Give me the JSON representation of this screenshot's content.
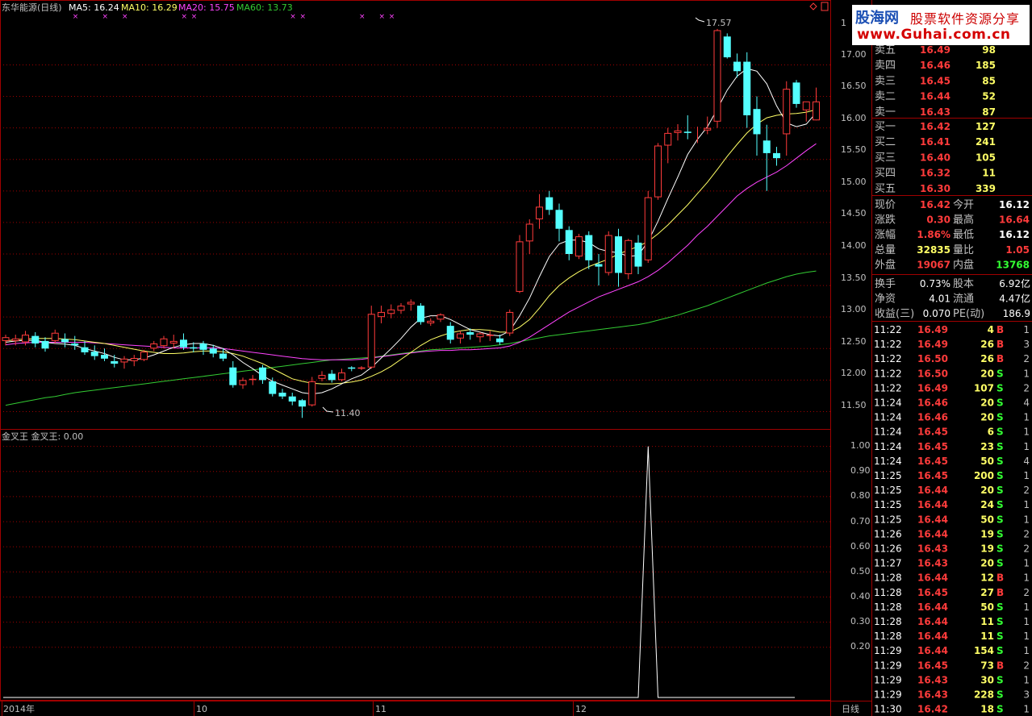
{
  "header": {
    "stock_title": "东华能源(日线)",
    "ma5": "MA5: 16.24",
    "ma10": "MA10: 16.29",
    "ma20": "MA20: 15.75",
    "ma60": "MA60: 13.73"
  },
  "colors": {
    "up": "#ff3b3b",
    "down": "#54ffff",
    "ma5": "#ffffff",
    "ma10": "#ffff66",
    "ma20": "#ff44ff",
    "ma60": "#33cc33",
    "grid": "#a00000"
  },
  "price_axis": {
    "ticks": [
      "17.00",
      "16.50",
      "16.00",
      "15.50",
      "15.00",
      "14.50",
      "14.00",
      "13.50",
      "13.00",
      "12.50",
      "12.00",
      "11.50"
    ],
    "top_partial": "1"
  },
  "annotations": {
    "high": "17.57",
    "low": "11.40"
  },
  "indicator": {
    "title": "金叉王 金叉王: 0.00",
    "ticks": [
      "1.00",
      "0.90",
      "0.80",
      "0.70",
      "0.60",
      "0.50",
      "0.40",
      "0.30",
      "0.20"
    ]
  },
  "date_axis": {
    "labels": [
      "2014年",
      "10",
      "11",
      "12"
    ],
    "period": "日线"
  },
  "logo": {
    "site": "股海网",
    "slogan": "股票软件资源分享",
    "url": "www.Guhai.com.cn"
  },
  "order_book": {
    "asks": [
      {
        "label": "卖五",
        "price": "16.49",
        "vol": "98"
      },
      {
        "label": "卖四",
        "price": "16.46",
        "vol": "185"
      },
      {
        "label": "卖三",
        "price": "16.45",
        "vol": "85"
      },
      {
        "label": "卖二",
        "price": "16.44",
        "vol": "52"
      },
      {
        "label": "卖一",
        "price": "16.43",
        "vol": "87"
      }
    ],
    "bids": [
      {
        "label": "买一",
        "price": "16.42",
        "vol": "127"
      },
      {
        "label": "买二",
        "price": "16.41",
        "vol": "241"
      },
      {
        "label": "买三",
        "price": "16.40",
        "vol": "105"
      },
      {
        "label": "买四",
        "price": "16.32",
        "vol": "11"
      },
      {
        "label": "买五",
        "price": "16.30",
        "vol": "339"
      }
    ]
  },
  "quote": [
    {
      "l1": "现价",
      "v1": "16.42",
      "l2": "今开",
      "v2": "16.12",
      "c1": "#ff3b3b",
      "c2": "#ffffff"
    },
    {
      "l1": "涨跌",
      "v1": "0.30",
      "l2": "最高",
      "v2": "16.64",
      "c1": "#ff3b3b",
      "c2": "#ff3b3b"
    },
    {
      "l1": "涨幅",
      "v1": "1.86%",
      "l2": "最低",
      "v2": "16.12",
      "c1": "#ff3b3b",
      "c2": "#ffffff"
    },
    {
      "l1": "总量",
      "v1": "32835",
      "l2": "量比",
      "v2": "1.05",
      "c1": "#ffff66",
      "c2": "#ff3b3b"
    },
    {
      "l1": "外盘",
      "v1": "19067",
      "l2": "内盘",
      "v2": "13768",
      "c1": "#ff3b3b",
      "c2": "#33ff33"
    }
  ],
  "fundamentals": [
    {
      "l1": "换手",
      "v1": "0.73%",
      "l2": "股本",
      "v2": "6.92亿"
    },
    {
      "l1": "净资",
      "v1": "4.01",
      "l2": "流通",
      "v2": "4.47亿"
    },
    {
      "l1": "收益(三)",
      "v1": "0.070",
      "l2": "PE(动)",
      "v2": "186.9"
    }
  ],
  "ticks": [
    {
      "time": "11:22",
      "price": "16.49",
      "vol": "4",
      "side": "B",
      "n": "1"
    },
    {
      "time": "11:22",
      "price": "16.49",
      "vol": "26",
      "side": "B",
      "n": "3"
    },
    {
      "time": "11:22",
      "price": "16.50",
      "vol": "26",
      "side": "B",
      "n": "2"
    },
    {
      "time": "11:22",
      "price": "16.50",
      "vol": "20",
      "side": "S",
      "n": "1"
    },
    {
      "time": "11:22",
      "price": "16.49",
      "vol": "107",
      "side": "S",
      "n": "2"
    },
    {
      "time": "11:24",
      "price": "16.46",
      "vol": "20",
      "side": "S",
      "n": "4"
    },
    {
      "time": "11:24",
      "price": "16.46",
      "vol": "20",
      "side": "S",
      "n": "1"
    },
    {
      "time": "11:24",
      "price": "16.45",
      "vol": "6",
      "side": "S",
      "n": "1"
    },
    {
      "time": "11:24",
      "price": "16.45",
      "vol": "23",
      "side": "S",
      "n": "1"
    },
    {
      "time": "11:24",
      "price": "16.45",
      "vol": "50",
      "side": "S",
      "n": "4"
    },
    {
      "time": "11:25",
      "price": "16.45",
      "vol": "200",
      "side": "S",
      "n": "1"
    },
    {
      "time": "11:25",
      "price": "16.44",
      "vol": "20",
      "side": "S",
      "n": "2"
    },
    {
      "time": "11:25",
      "price": "16.44",
      "vol": "24",
      "side": "S",
      "n": "1"
    },
    {
      "time": "11:25",
      "price": "16.44",
      "vol": "50",
      "side": "S",
      "n": "1"
    },
    {
      "time": "11:26",
      "price": "16.44",
      "vol": "19",
      "side": "S",
      "n": "2"
    },
    {
      "time": "11:26",
      "price": "16.43",
      "vol": "19",
      "side": "S",
      "n": "2"
    },
    {
      "time": "11:27",
      "price": "16.43",
      "vol": "20",
      "side": "S",
      "n": "1"
    },
    {
      "time": "11:28",
      "price": "16.44",
      "vol": "12",
      "side": "B",
      "n": "1"
    },
    {
      "time": "11:28",
      "price": "16.45",
      "vol": "27",
      "side": "B",
      "n": "2"
    },
    {
      "time": "11:28",
      "price": "16.44",
      "vol": "50",
      "side": "S",
      "n": "1"
    },
    {
      "time": "11:28",
      "price": "16.44",
      "vol": "11",
      "side": "S",
      "n": "1"
    },
    {
      "time": "11:28",
      "price": "16.44",
      "vol": "11",
      "side": "S",
      "n": "1"
    },
    {
      "time": "11:29",
      "price": "16.44",
      "vol": "154",
      "side": "S",
      "n": "1"
    },
    {
      "time": "11:29",
      "price": "16.45",
      "vol": "73",
      "side": "B",
      "n": "2"
    },
    {
      "time": "11:29",
      "price": "16.43",
      "vol": "30",
      "side": "S",
      "n": "1"
    },
    {
      "time": "11:29",
      "price": "16.43",
      "vol": "228",
      "side": "S",
      "n": "3"
    },
    {
      "time": "11:30",
      "price": "16.42",
      "vol": "18",
      "side": "S",
      "n": "1"
    }
  ],
  "chart_data": {
    "type": "candlestick",
    "candles": [
      [
        12.62,
        12.72,
        12.55,
        12.68
      ],
      [
        12.62,
        12.72,
        12.55,
        12.66
      ],
      [
        12.6,
        12.78,
        12.55,
        12.72
      ],
      [
        12.7,
        12.76,
        12.52,
        12.58
      ],
      [
        12.62,
        12.68,
        12.45,
        12.5
      ],
      [
        12.62,
        12.8,
        12.58,
        12.75
      ],
      [
        12.65,
        12.74,
        12.52,
        12.6
      ],
      [
        12.58,
        12.7,
        12.48,
        12.55
      ],
      [
        12.52,
        12.62,
        12.4,
        12.44
      ],
      [
        12.45,
        12.55,
        12.32,
        12.38
      ],
      [
        12.4,
        12.5,
        12.3,
        12.34
      ],
      [
        12.3,
        12.4,
        12.2,
        12.26
      ],
      [
        12.28,
        12.38,
        12.18,
        12.34
      ],
      [
        12.3,
        12.4,
        12.22,
        12.35
      ],
      [
        12.32,
        12.48,
        12.3,
        12.45
      ],
      [
        12.5,
        12.62,
        12.46,
        12.58
      ],
      [
        12.54,
        12.7,
        12.5,
        12.66
      ],
      [
        12.58,
        12.72,
        12.5,
        12.62
      ],
      [
        12.64,
        12.74,
        12.48,
        12.52
      ],
      [
        12.52,
        12.6,
        12.44,
        12.5
      ],
      [
        12.58,
        12.62,
        12.4,
        12.48
      ],
      [
        12.5,
        12.56,
        12.36,
        12.42
      ],
      [
        12.42,
        12.5,
        12.3,
        12.34
      ],
      [
        12.2,
        12.3,
        11.88,
        11.92
      ],
      [
        11.92,
        12.04,
        11.86,
        12.0
      ],
      [
        12.0,
        12.08,
        11.92,
        12.02
      ],
      [
        12.2,
        12.24,
        11.94,
        12.0
      ],
      [
        11.98,
        12.04,
        11.74,
        11.78
      ],
      [
        11.8,
        11.86,
        11.7,
        11.74
      ],
      [
        11.74,
        11.8,
        11.6,
        11.66
      ],
      [
        11.68,
        11.7,
        11.4,
        11.58
      ],
      [
        11.6,
        12.05,
        11.58,
        11.98
      ],
      [
        12.02,
        12.14,
        11.98,
        12.08
      ],
      [
        12.1,
        12.16,
        11.96,
        12.0
      ],
      [
        12.0,
        12.18,
        11.98,
        12.12
      ],
      [
        12.2,
        12.22,
        12.14,
        12.18
      ],
      [
        12.18,
        12.22,
        12.16,
        12.2
      ],
      [
        12.2,
        13.18,
        12.18,
        13.05
      ],
      [
        13.0,
        13.18,
        12.9,
        13.08
      ],
      [
        13.05,
        13.2,
        12.98,
        13.12
      ],
      [
        13.1,
        13.22,
        13.05,
        13.18
      ],
      [
        13.2,
        13.28,
        13.1,
        13.24
      ],
      [
        13.18,
        13.22,
        12.88,
        12.92
      ],
      [
        12.9,
        12.98,
        12.86,
        12.94
      ],
      [
        12.96,
        13.06,
        12.92,
        13.04
      ],
      [
        12.86,
        12.92,
        12.58,
        12.64
      ],
      [
        12.66,
        12.78,
        12.58,
        12.74
      ],
      [
        12.76,
        12.82,
        12.64,
        12.72
      ],
      [
        12.68,
        12.76,
        12.6,
        12.74
      ],
      [
        12.7,
        12.78,
        12.62,
        12.72
      ],
      [
        12.66,
        12.72,
        12.56,
        12.6
      ],
      [
        12.74,
        13.12,
        12.7,
        13.08
      ],
      [
        13.4,
        14.3,
        13.38,
        14.2
      ],
      [
        14.2,
        14.55,
        14.0,
        14.48
      ],
      [
        14.55,
        14.95,
        14.4,
        14.75
      ],
      [
        14.9,
        15.0,
        14.62,
        14.7
      ],
      [
        14.7,
        14.8,
        14.2,
        14.4
      ],
      [
        14.38,
        14.44,
        13.9,
        14.0
      ],
      [
        13.96,
        14.32,
        13.92,
        14.28
      ],
      [
        14.3,
        14.36,
        13.76,
        13.9
      ],
      [
        13.84,
        14.0,
        13.5,
        13.8
      ],
      [
        13.7,
        14.36,
        13.66,
        14.3
      ],
      [
        14.28,
        14.4,
        13.48,
        13.7
      ],
      [
        13.68,
        14.24,
        13.6,
        14.22
      ],
      [
        14.18,
        14.3,
        13.68,
        13.8
      ],
      [
        13.9,
        15.0,
        13.86,
        14.9
      ],
      [
        14.9,
        15.76,
        14.86,
        15.72
      ],
      [
        15.72,
        16.0,
        15.44,
        15.92
      ],
      [
        15.92,
        16.06,
        15.8,
        15.96
      ],
      [
        15.94,
        16.2,
        15.82,
        15.92
      ],
      [
        15.9,
        16.02,
        15.76,
        15.9
      ],
      [
        15.96,
        16.18,
        15.9,
        16.0
      ],
      [
        16.1,
        17.57,
        16.0,
        17.55
      ],
      [
        17.45,
        17.5,
        17.1,
        17.12
      ],
      [
        17.05,
        17.18,
        16.8,
        16.9
      ],
      [
        17.05,
        17.2,
        16.0,
        16.2
      ],
      [
        16.3,
        16.5,
        15.56,
        15.9
      ],
      [
        15.8,
        16.05,
        15.0,
        15.6
      ],
      [
        15.6,
        15.7,
        15.4,
        15.52
      ],
      [
        15.9,
        16.74,
        15.56,
        16.62
      ],
      [
        16.72,
        16.76,
        16.32,
        16.38
      ],
      [
        16.28,
        16.4,
        16.1,
        16.42
      ],
      [
        16.12,
        16.64,
        16.12,
        16.42
      ]
    ],
    "ma5": [
      12.6,
      12.62,
      12.63,
      12.63,
      12.6,
      12.58,
      12.57,
      12.55,
      12.5,
      12.46,
      12.42,
      12.36,
      12.32,
      12.32,
      12.35,
      12.4,
      12.46,
      12.52,
      12.56,
      12.58,
      12.58,
      12.55,
      12.5,
      12.4,
      12.28,
      12.18,
      12.07,
      11.98,
      11.92,
      11.86,
      11.8,
      11.78,
      11.8,
      11.86,
      11.94,
      12.02,
      12.08,
      12.2,
      12.35,
      12.5,
      12.66,
      12.84,
      12.98,
      13.02,
      13.02,
      12.96,
      12.88,
      12.8,
      12.76,
      12.72,
      12.7,
      12.78,
      13.02,
      13.3,
      13.64,
      13.96,
      14.16,
      14.22,
      14.22,
      14.18,
      14.08,
      14.04,
      14.02,
      13.96,
      13.98,
      14.2,
      14.52,
      14.88,
      15.22,
      15.58,
      15.82,
      16.02,
      16.3,
      16.6,
      16.82,
      16.94,
      16.9,
      16.7,
      16.35,
      16.08,
      16.02,
      16.06,
      16.24
    ],
    "ma10": [
      12.62,
      12.64,
      12.65,
      12.66,
      12.66,
      12.66,
      12.65,
      12.64,
      12.62,
      12.6,
      12.58,
      12.55,
      12.52,
      12.49,
      12.46,
      12.44,
      12.42,
      12.42,
      12.43,
      12.45,
      12.46,
      12.46,
      12.45,
      12.42,
      12.38,
      12.32,
      12.26,
      12.18,
      12.1,
      12.02,
      11.98,
      11.95,
      11.94,
      11.94,
      11.95,
      11.97,
      12.0,
      12.06,
      12.13,
      12.22,
      12.33,
      12.44,
      12.55,
      12.64,
      12.7,
      12.75,
      12.78,
      12.8,
      12.8,
      12.79,
      12.76,
      12.76,
      12.84,
      12.96,
      13.14,
      13.34,
      13.5,
      13.62,
      13.72,
      13.8,
      13.86,
      13.92,
      14.0,
      14.06,
      14.12,
      14.2,
      14.32,
      14.46,
      14.62,
      14.78,
      14.96,
      15.14,
      15.34,
      15.55,
      15.74,
      15.92,
      16.06,
      16.16,
      16.2,
      16.22,
      16.23,
      16.25,
      16.29
    ],
    "ma20": [
      12.56,
      12.58,
      12.59,
      12.6,
      12.6,
      12.6,
      12.6,
      12.6,
      12.6,
      12.59,
      12.58,
      12.57,
      12.56,
      12.55,
      12.54,
      12.53,
      12.52,
      12.51,
      12.51,
      12.51,
      12.51,
      12.51,
      12.5,
      12.48,
      12.46,
      12.44,
      12.42,
      12.4,
      12.38,
      12.36,
      12.34,
      12.33,
      12.32,
      12.32,
      12.32,
      12.32,
      12.33,
      12.35,
      12.37,
      12.39,
      12.41,
      12.43,
      12.45,
      12.46,
      12.47,
      12.47,
      12.48,
      12.48,
      12.49,
      12.5,
      12.51,
      12.54,
      12.6,
      12.68,
      12.78,
      12.88,
      12.98,
      13.08,
      13.16,
      13.24,
      13.32,
      13.38,
      13.44,
      13.5,
      13.56,
      13.64,
      13.74,
      13.86,
      14.0,
      14.14,
      14.3,
      14.44,
      14.6,
      14.76,
      14.92,
      15.04,
      15.14,
      15.22,
      15.3,
      15.4,
      15.52,
      15.64,
      15.75
    ],
    "ma60": [
      11.6,
      11.63,
      11.66,
      11.69,
      11.72,
      11.74,
      11.77,
      11.8,
      11.82,
      11.84,
      11.86,
      11.88,
      11.9,
      11.92,
      11.94,
      11.96,
      11.98,
      12.0,
      12.02,
      12.04,
      12.06,
      12.08,
      12.1,
      12.12,
      12.14,
      12.16,
      12.18,
      12.2,
      12.22,
      12.24,
      12.26,
      12.28,
      12.3,
      12.32,
      12.33,
      12.34,
      12.35,
      12.36,
      12.38,
      12.4,
      12.42,
      12.44,
      12.46,
      12.48,
      12.49,
      12.5,
      12.51,
      12.52,
      12.53,
      12.54,
      12.56,
      12.58,
      12.61,
      12.64,
      12.67,
      12.7,
      12.72,
      12.74,
      12.76,
      12.78,
      12.8,
      12.82,
      12.84,
      12.86,
      12.88,
      12.91,
      12.95,
      12.99,
      13.03,
      13.08,
      13.13,
      13.18,
      13.24,
      13.3,
      13.36,
      13.42,
      13.48,
      13.54,
      13.59,
      13.64,
      13.68,
      13.71,
      13.73
    ],
    "signal_index": 65,
    "signal_markers": [
      7,
      10,
      12,
      18,
      19,
      29,
      30,
      36,
      38,
      39
    ],
    "y_range": [
      11.25,
      17.85
    ],
    "indicator_range": [
      0,
      1.05
    ]
  }
}
